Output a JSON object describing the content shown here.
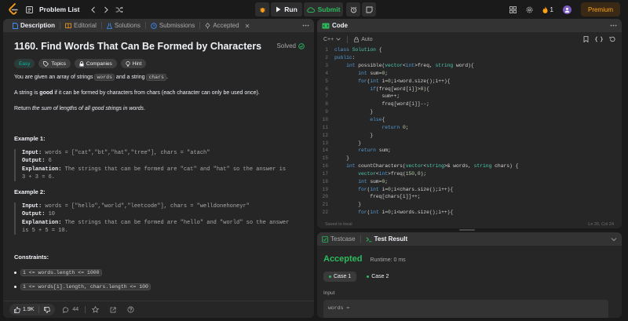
{
  "topbar": {
    "problem_list": "Problem List",
    "run": "Run",
    "submit": "Submit",
    "streak": "1",
    "premium": "Premium",
    "colors": {
      "accent": "#ffa116",
      "green": "#2cbb5d"
    }
  },
  "desc_tabs": [
    {
      "label": "Description"
    },
    {
      "label": "Editorial"
    },
    {
      "label": "Solutions"
    },
    {
      "label": "Submissions"
    },
    {
      "label": "Accepted"
    }
  ],
  "problem": {
    "title": "1160. Find Words That Can Be Formed by Characters",
    "solved": "Solved",
    "tags": {
      "difficulty": "Easy",
      "topics": "Topics",
      "companies": "Companies",
      "hint": "Hint"
    },
    "p1_a": "You are given an array of strings ",
    "p1_code1": "words",
    "p1_b": " and a string ",
    "p1_code2": "chars",
    "p1_c": ".",
    "p2_a": "A string is ",
    "p2_bold": "good",
    "p2_b": " if it can be formed by characters from chars (each character can only be used once).",
    "p3_a": "Return ",
    "p3_italic": "the sum of lengths of all good strings in words",
    "p3_b": ".",
    "ex1": {
      "heading": "Example 1:",
      "input_label": "Input:",
      "input": " words = [\"cat\",\"bt\",\"hat\",\"tree\"], chars = \"atach\"",
      "output_label": "Output:",
      "output": " 6",
      "expl_label": "Explanation:",
      "expl1": " The strings that can be formed are \"cat\" and \"hat\" so the answer is",
      "expl2": "3 + 3 = 6."
    },
    "ex2": {
      "heading": "Example 2:",
      "input_label": "Input:",
      "input": " words = [\"hello\",\"world\",\"leetcode\"], chars = \"welldonehoneyr\"",
      "output_label": "Output:",
      "output": " 10",
      "expl_label": "Explanation:",
      "expl1": " The strings that can be formed are \"hello\" and \"world\" so the answer",
      "expl2": "is 5 + 5 = 10."
    },
    "constraints_heading": "Constraints:",
    "constraints": [
      "1 <= words.length <= 1000",
      "1 <= words[i].length, chars.length <= 100"
    ],
    "likes": "1.9K",
    "comments": "44"
  },
  "code_panel": {
    "title": "Code",
    "language": "C++",
    "auto": "Auto",
    "saved": "Saved to local",
    "cursor": "Ln 26, Col 24"
  },
  "code_lines": [
    {
      "n": "1",
      "code": "class Solution {"
    },
    {
      "n": "2",
      "code": "public:"
    },
    {
      "n": "3",
      "code": "    int possible(vector<int>freq, string word){"
    },
    {
      "n": "4",
      "code": "        int sum=0;"
    },
    {
      "n": "5",
      "code": "        for(int i=0;i<word.size();i++){"
    },
    {
      "n": "6",
      "code": "            if(freq[word[i]]>0){"
    },
    {
      "n": "7",
      "code": "                sum++;"
    },
    {
      "n": "8",
      "code": "                freq[word[i]]--;"
    },
    {
      "n": "9",
      "code": "            }"
    },
    {
      "n": "10",
      "code": "            else{"
    },
    {
      "n": "11",
      "code": "                return 0;"
    },
    {
      "n": "12",
      "code": "            }"
    },
    {
      "n": "13",
      "code": "        }"
    },
    {
      "n": "14",
      "code": "        return sum;"
    },
    {
      "n": "15",
      "code": "    }"
    },
    {
      "n": "16",
      "code": "    int countCharacters(vector<string>& words, string chars) {"
    },
    {
      "n": "17",
      "code": "        vector<int>freq(150,0);"
    },
    {
      "n": "18",
      "code": "        int sum=0;"
    },
    {
      "n": "19",
      "code": "        for(int i=0;i<chars.size();i++){"
    },
    {
      "n": "20",
      "code": "            freq[chars[i]]++;"
    },
    {
      "n": "21",
      "code": "        }"
    },
    {
      "n": "22",
      "code": "        for(int i=0;i<words.size();i++){"
    }
  ],
  "result_panel": {
    "tab_testcase": "Testcase",
    "tab_result": "Test Result",
    "status": "Accepted",
    "runtime": "Runtime: 0 ms",
    "case1": "Case 1",
    "case2": "Case 2",
    "input_label": "Input",
    "words_label": "words ="
  }
}
